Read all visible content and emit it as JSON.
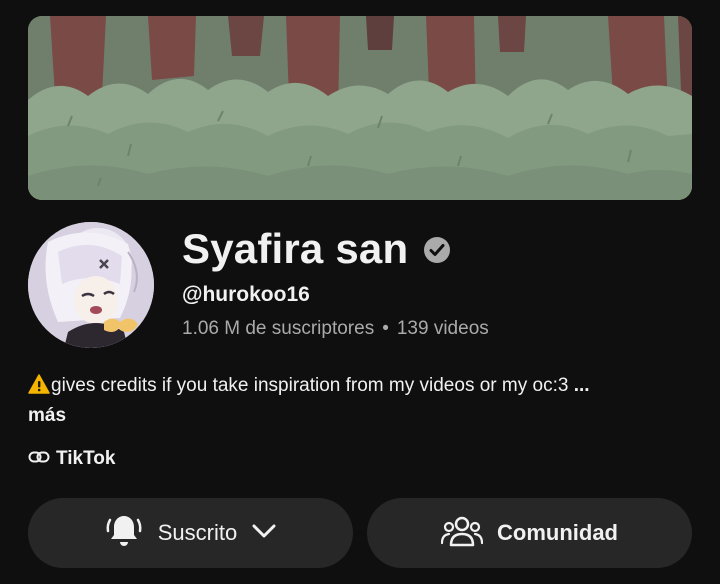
{
  "channel": {
    "name": "Syafira san",
    "handle": "@hurokoo16",
    "subscribers": "1.06 M de suscriptores",
    "separator": "•",
    "videos": "139 videos"
  },
  "description": {
    "text": "gives credits if you take inspiration from my videos or my oc:3",
    "ellipsis": "...",
    "more_label": "más"
  },
  "links": {
    "primary_label": "TikTok"
  },
  "buttons": {
    "subscribed_label": "Suscrito",
    "community_label": "Comunidad"
  },
  "icons": {
    "verified": "verified-check-icon",
    "warning": "warning-icon",
    "link": "link-icon",
    "bell": "bell-ringing-icon",
    "chevron": "chevron-down-icon",
    "community": "people-group-icon"
  },
  "colors": {
    "background": "#0f0f0f",
    "button_bg": "#272727",
    "text_primary": "#f1f1f1",
    "text_secondary": "#aaaaaa",
    "warning": "#f4b400"
  }
}
